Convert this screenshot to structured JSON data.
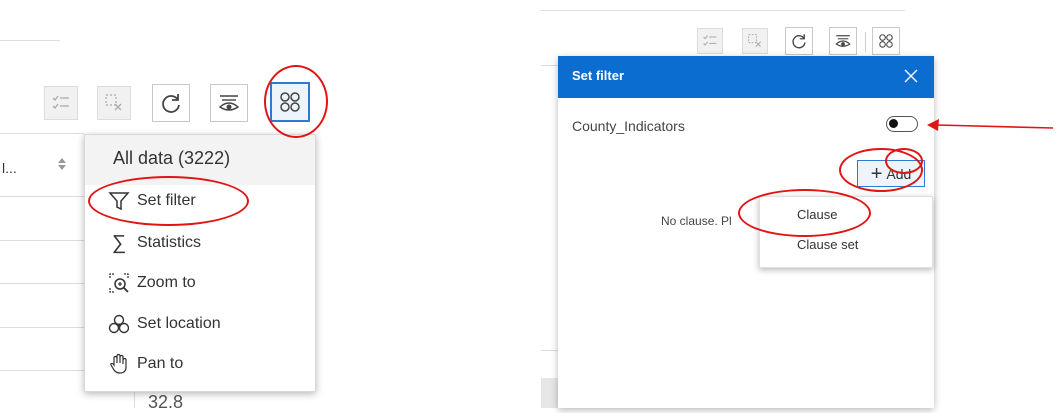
{
  "left": {
    "toolbar": {
      "buttons": [
        {
          "name": "select-rows-icon",
          "state": "disabled"
        },
        {
          "name": "clear-selection-icon",
          "state": "disabled"
        },
        {
          "name": "refresh-icon",
          "state": "enabled"
        },
        {
          "name": "show-hide-columns-icon",
          "state": "enabled"
        },
        {
          "name": "more-options-icon",
          "state": "active"
        }
      ]
    },
    "table": {
      "column_header_fragment": "l...",
      "cell_value_fragment": "32.8"
    },
    "menu": {
      "header": "All data (3222)",
      "items": [
        {
          "label": "Set filter",
          "icon": "filter-icon"
        },
        {
          "label": "Statistics",
          "icon": "sigma-icon"
        },
        {
          "label": "Zoom to",
          "icon": "zoom-to-icon"
        },
        {
          "label": "Set location",
          "icon": "set-location-icon"
        },
        {
          "label": "Pan to",
          "icon": "pan-hand-icon"
        }
      ]
    }
  },
  "right": {
    "panel": {
      "title": "Set filter",
      "layer_name": "County_Indicators",
      "toggle_on": false,
      "add_label": "Add",
      "no_clause_text": "No clause. Pl",
      "dropdown": [
        "Clause",
        "Clause set"
      ]
    }
  },
  "colors": {
    "accent_blue": "#0b6dcf",
    "annotation_red": "#e01515",
    "active_outline": "#2d7bd1"
  }
}
